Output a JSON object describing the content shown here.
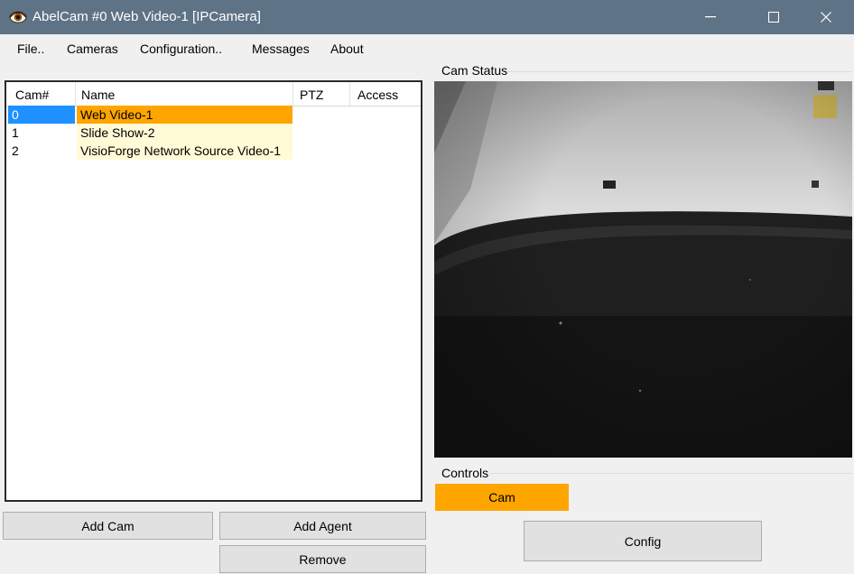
{
  "window": {
    "title": "AbelCam #0 Web Video-1 [IPCamera]",
    "icon": "eye-icon"
  },
  "menu": [
    "File..",
    "Cameras",
    "Configuration..",
    "Messages",
    "About"
  ],
  "camera_list": {
    "columns": [
      "Cam#",
      "Name",
      "PTZ",
      "Access"
    ],
    "rows": [
      {
        "id": "0",
        "name": "Web Video-1",
        "selected": true
      },
      {
        "id": "1",
        "name": "Slide Show-2",
        "selected": false
      },
      {
        "id": "2",
        "name": "VisioForge Network Source Video-1",
        "selected": false
      }
    ]
  },
  "buttons": {
    "add_cam": "Add Cam",
    "add_agent": "Add Agent",
    "remove": "Remove"
  },
  "cam_status": {
    "label": "Cam Status"
  },
  "controls": {
    "label": "Controls",
    "cam_button": "Cam",
    "config_button": "Config"
  },
  "colors": {
    "titlebar": "#5f7387",
    "selection_orange": "#ffa500",
    "selection_blue": "#1e90ff",
    "row_yellow": "#fffbd6"
  }
}
